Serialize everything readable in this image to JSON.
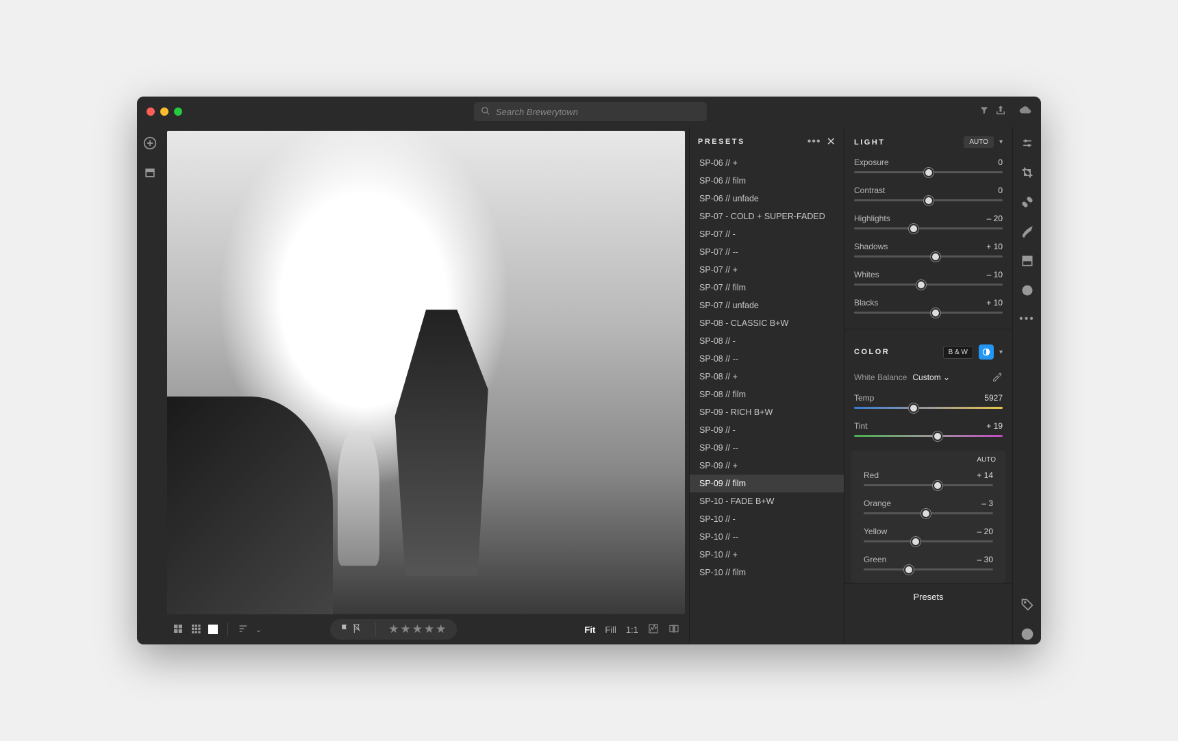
{
  "search": {
    "placeholder": "Search Brewerytown"
  },
  "presets": {
    "title": "PRESETS",
    "selected_index": 18,
    "items": [
      "SP-06 // +",
      "SP-06 // film",
      "SP-06 // unfade",
      "SP-07 - COLD + SUPER-FADED",
      "SP-07 // -",
      "SP-07 // --",
      "SP-07 // +",
      "SP-07 // film",
      "SP-07 // unfade",
      "SP-08 - CLASSIC B+W",
      "SP-08 // -",
      "SP-08 // --",
      "SP-08 // +",
      "SP-08 // film",
      "SP-09 - RICH B+W",
      "SP-09 // -",
      "SP-09 // --",
      "SP-09 // +",
      "SP-09 // film",
      "SP-10 - FADE B+W",
      "SP-10 // -",
      "SP-10 // --",
      "SP-10 // +",
      "SP-10 // film"
    ]
  },
  "light": {
    "title": "LIGHT",
    "auto": "AUTO",
    "sliders": [
      {
        "label": "Exposure",
        "value": "0",
        "pos": 50
      },
      {
        "label": "Contrast",
        "value": "0",
        "pos": 50
      },
      {
        "label": "Highlights",
        "value": "– 20",
        "pos": 40
      },
      {
        "label": "Shadows",
        "value": "+ 10",
        "pos": 55
      },
      {
        "label": "Whites",
        "value": "– 10",
        "pos": 45
      },
      {
        "label": "Blacks",
        "value": "+ 10",
        "pos": 55
      }
    ]
  },
  "color": {
    "title": "COLOR",
    "bw": "B & W",
    "wb_label": "White Balance",
    "wb_value": "Custom",
    "temp": {
      "label": "Temp",
      "value": "5927",
      "pos": 40
    },
    "tint": {
      "label": "Tint",
      "value": "+ 19",
      "pos": 56
    },
    "mix_auto": "AUTO",
    "mix": [
      {
        "label": "Red",
        "value": "+ 14",
        "pos": 57
      },
      {
        "label": "Orange",
        "value": "– 3",
        "pos": 48
      },
      {
        "label": "Yellow",
        "value": "– 20",
        "pos": 40
      },
      {
        "label": "Green",
        "value": "– 30",
        "pos": 35
      }
    ]
  },
  "footer_button": "Presets",
  "zoom": {
    "fit": "Fit",
    "fill": "Fill",
    "one": "1:1"
  }
}
